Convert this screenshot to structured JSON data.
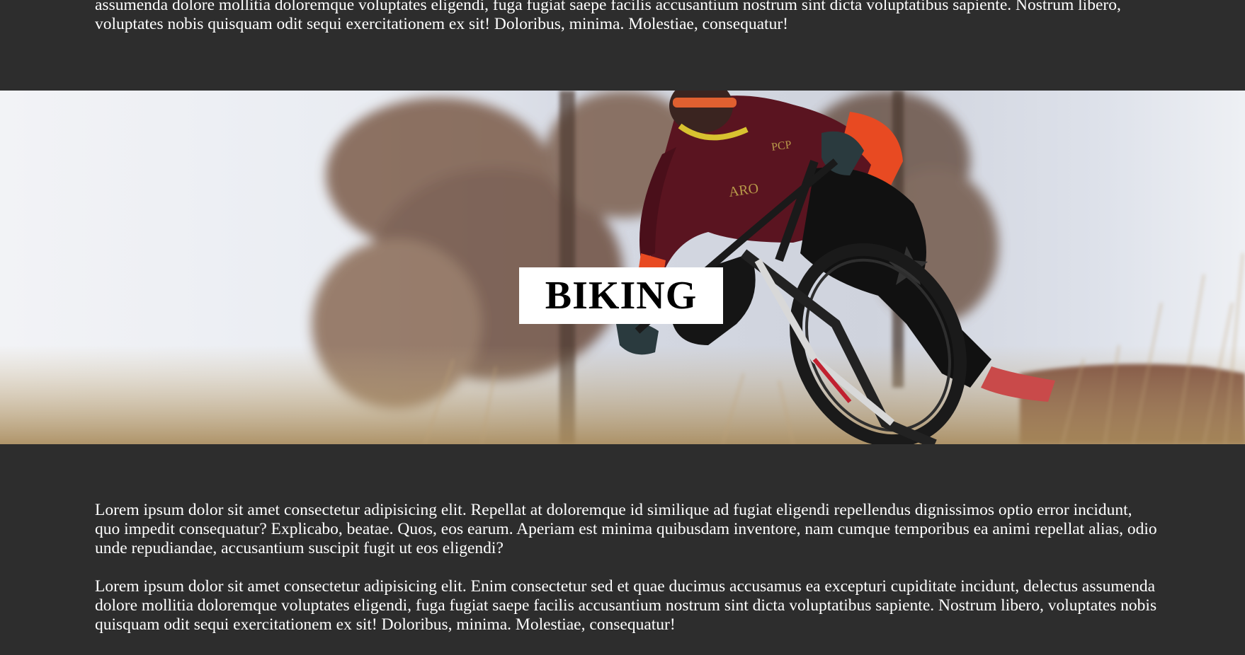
{
  "section_intro": {
    "paragraph_tail": "assumenda dolore mollitia doloremque voluptates eligendi, fuga fugiat saepe facilis accusantium nostrum sint dicta voluptatibus sapiente. Nostrum libero, voluptates nobis quisquam odit sequi exercitationem ex sit! Doloribus, minima. Molestiae, consequatur!"
  },
  "banner": {
    "title": "BIKING"
  },
  "section_biking": {
    "paragraphs": [
      "Lorem ipsum dolor sit amet consectetur adipisicing elit. Repellat at doloremque id similique ad fugiat eligendi repellendus dignissimos optio error incidunt, quo impedit consequatur? Explicabo, beatae. Quos, eos earum. Aperiam est minima quibusdam inventore, nam cumque temporibus ea animi repellat alias, odio unde repudiandae, accusantium suscipit fugit ut eos eligendi?",
      "Lorem ipsum dolor sit amet consectetur adipisicing elit. Enim consectetur sed et quae ducimus accusamus ea excepturi cupiditate incidunt, delectus assumenda dolore mollitia doloremque voluptates eligendi, fuga fugiat saepe facilis accusantium nostrum sint dicta voluptatibus sapiente. Nostrum libero, voluptates nobis quisquam odit sequi exercitationem ex sit! Doloribus, minima. Molestiae, consequatur!"
    ]
  }
}
